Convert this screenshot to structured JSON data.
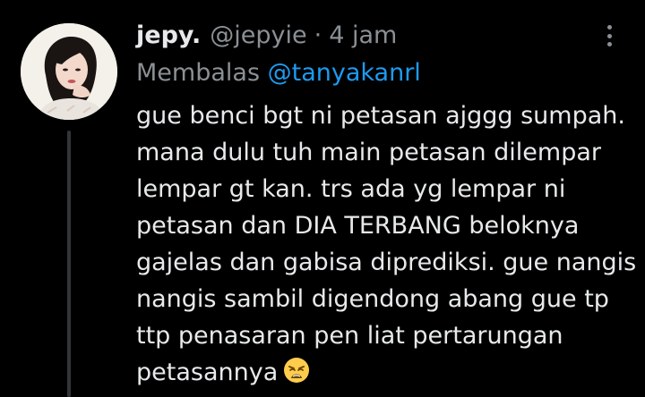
{
  "tweet": {
    "display_name": "jepy.",
    "handle": "@jepyie",
    "separator": "·",
    "time": "4 jam",
    "reply_label": "Membalas",
    "reply_mention": "@tanyakanrl",
    "lines": [
      "gue benci bgt ni petasan ajggg sumpah.",
      "mana dulu tuh main petasan dilempar",
      "lempar gt kan. trs ada yg lempar ni",
      "petasan dan DIA TERBANG beloknya",
      "gajelas dan gabisa diprediksi. gue nangis",
      "nangis sambil digendong abang gue tp",
      "ttp penasaran pen liat pertarungan",
      "petasannya"
    ],
    "trailing_emoji": "weary-face-icon"
  },
  "colors": {
    "background": "#000000",
    "primary_text": "#e7e9ea",
    "secondary_text": "#8b9095",
    "link": "#1d9bf0",
    "thread_line": "#333639"
  }
}
